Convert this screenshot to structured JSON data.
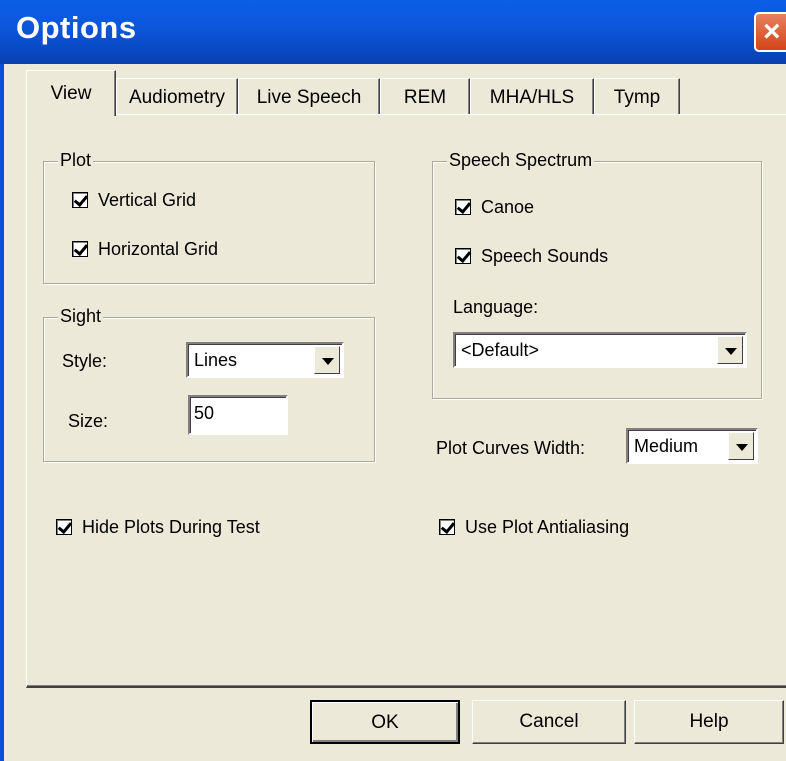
{
  "window": {
    "title": "Options",
    "close_glyph": "×"
  },
  "tabs": [
    {
      "label": "View",
      "active": true
    },
    {
      "label": "Audiometry"
    },
    {
      "label": "Live Speech"
    },
    {
      "label": "REM"
    },
    {
      "label": "MHA/HLS"
    },
    {
      "label": "Tymp"
    }
  ],
  "plot": {
    "title": "Plot",
    "vertical_grid": {
      "label": "Vertical Grid",
      "checked": true
    },
    "horizontal_grid": {
      "label": "Horizontal Grid",
      "checked": true
    }
  },
  "sight": {
    "title": "Sight",
    "style_label": "Style:",
    "style_value": "Lines",
    "size_label": "Size:",
    "size_value": "50"
  },
  "speech_spectrum": {
    "title": "Speech Spectrum",
    "canoe": {
      "label": "Canoe",
      "checked": true
    },
    "speech_sounds": {
      "label": "Speech Sounds",
      "checked": true
    },
    "language_label": "Language:",
    "language_value": "<Default>"
  },
  "plot_curves_width": {
    "label": "Plot Curves Width:",
    "value": "Medium"
  },
  "hide_plots": {
    "label": "Hide Plots During Test",
    "checked": true
  },
  "antialiasing": {
    "label": "Use Plot Antialiasing",
    "checked": true
  },
  "buttons": {
    "ok": "OK",
    "cancel": "Cancel",
    "help": "Help"
  },
  "colors": {
    "titlebar": "#0a5ee8",
    "dialog_bg": "#ece9d8",
    "close": "#d4441a"
  }
}
